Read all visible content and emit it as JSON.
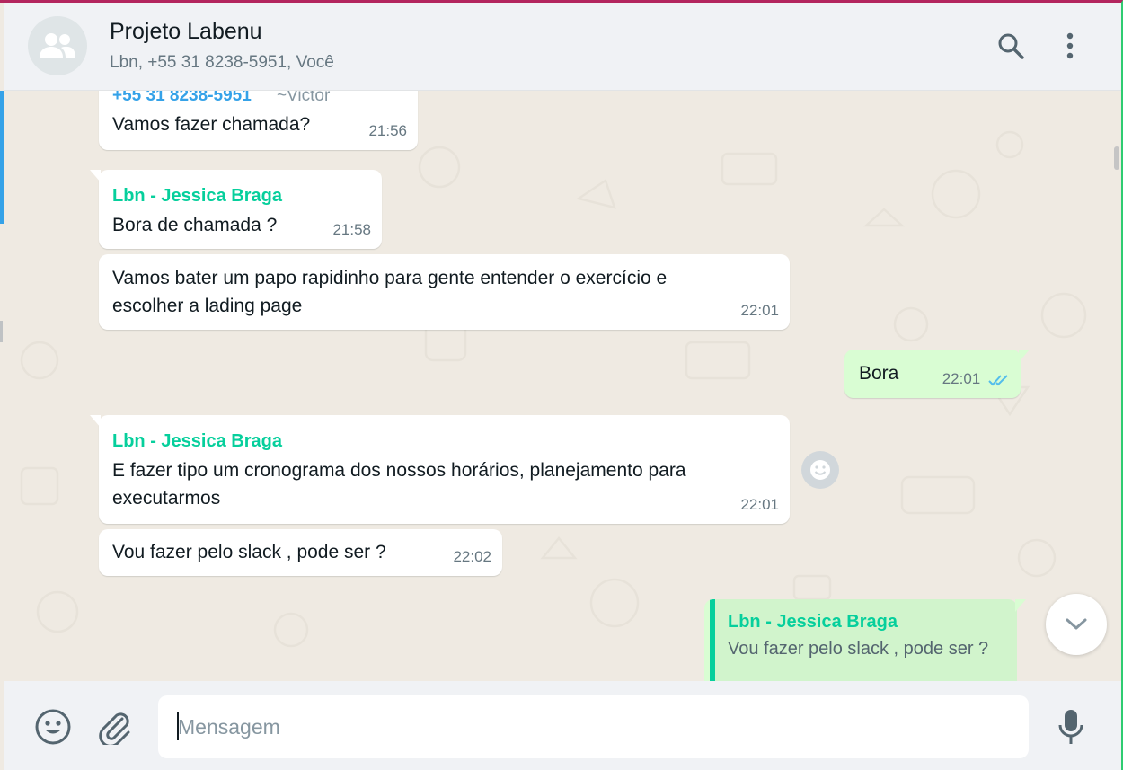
{
  "header": {
    "title": "Projeto Labenu",
    "subtitle": "Lbn, +55 31 8238-5951, Você"
  },
  "messages": [
    {
      "sender": "+55 31 8238-5951",
      "sender_alias": "~Victor",
      "text": "Vamos fazer chamada?",
      "time": "21:56"
    },
    {
      "sender": "Lbn - Jessica Braga",
      "text": "Bora de chamada ?",
      "time": "21:58"
    },
    {
      "text_line1": "Vamos bater um papo rapidinho para gente entender o exercício e",
      "text_line2": "escolher a lading page",
      "time": "22:01"
    },
    {
      "outgoing": true,
      "text": "Bora",
      "time": "22:01",
      "status": "read"
    },
    {
      "sender": "Lbn - Jessica Braga",
      "text_line1": "E fazer tipo um cronograma dos nossos horários, planejamento para",
      "text_line2": "executarmos",
      "time": "22:01"
    },
    {
      "text": "Vou fazer pelo slack , pode ser ?",
      "time": "22:02"
    }
  ],
  "reply_quote": {
    "sender": "Lbn - Jessica Braga",
    "text": "Vou fazer pelo slack , pode ser ?"
  },
  "composer": {
    "placeholder": "Mensagem"
  },
  "colors": {
    "accent": "#06cf9c",
    "read_ticks": "#53bdeb",
    "outgoing_bubble": "#d9fdd3",
    "top_bar": "#b3265e"
  },
  "icons": {
    "avatar": "group-icon",
    "search": "search-icon",
    "menu": "kebab-menu-icon",
    "react": "emoji-icon",
    "scroll": "chevron-down-icon",
    "emoji": "emoji-icon",
    "attach": "paperclip-icon",
    "mic": "microphone-icon"
  }
}
